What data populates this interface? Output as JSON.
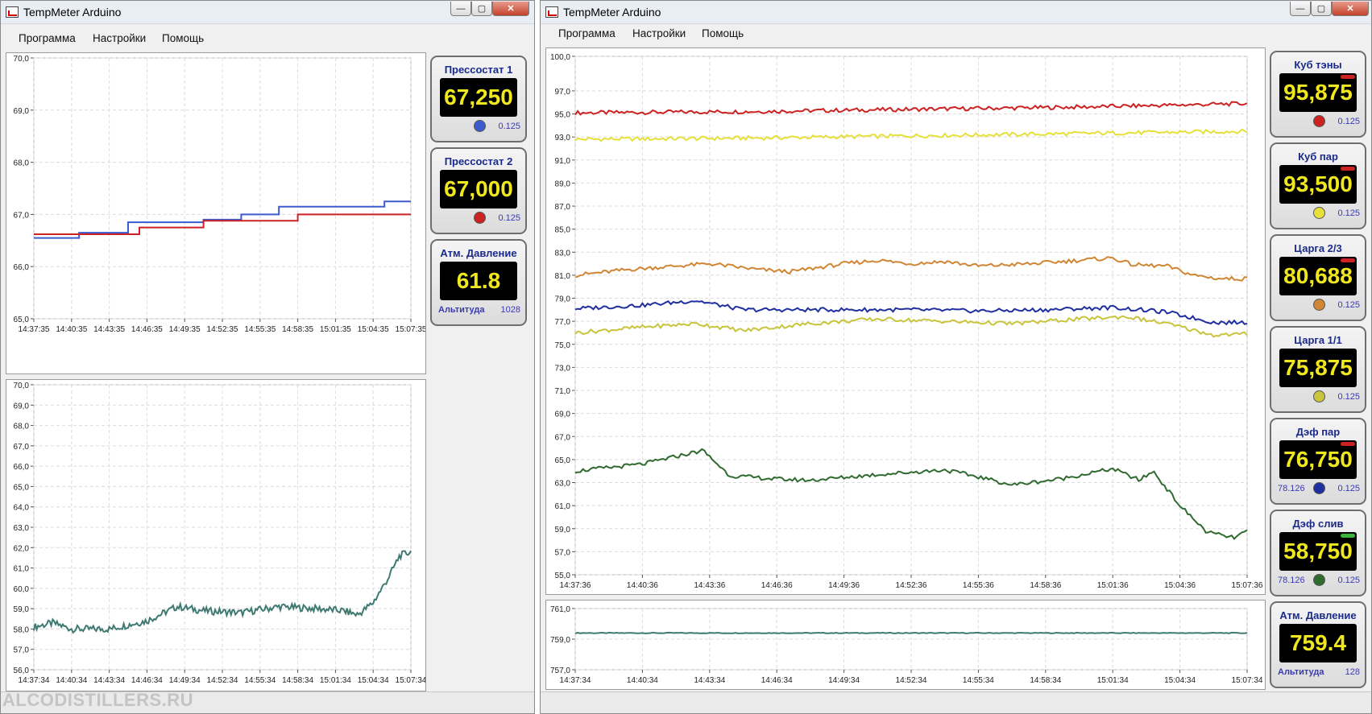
{
  "colors": {
    "red": "#cc2222",
    "yellow": "#e6e03a",
    "orange": "#d08634",
    "blue": "#1f2fa0",
    "olive": "#c8c43c",
    "green": "#2f6a2f",
    "teal": "#3e7a72",
    "plotblue": "#3b5bd0"
  },
  "left_window": {
    "title": "TempMeter Arduino",
    "controls": {
      "minimize": "—",
      "maximize": "▢",
      "close": "✕"
    },
    "menu": [
      "Программа",
      "Настройки",
      "Помощь"
    ],
    "chart_data": [
      {
        "type": "line",
        "ylim": [
          65.0,
          70.0
        ],
        "yticks": [
          "70,0",
          "69,0",
          "68,0",
          "67,0",
          "66,0",
          "65,0"
        ],
        "xticks": [
          "14:37:35",
          "14:40:35",
          "14:43:35",
          "14:46:35",
          "14:49:35",
          "14:52:35",
          "14:55:35",
          "14:58:35",
          "15:01:35",
          "15:04:35",
          "15:07:35"
        ],
        "series": [
          {
            "color": "plotblue",
            "points": [
              [
                0,
                66.55
              ],
              [
                0.12,
                66.55
              ],
              [
                0.12,
                66.65
              ],
              [
                0.25,
                66.65
              ],
              [
                0.25,
                66.85
              ],
              [
                0.45,
                66.85
              ],
              [
                0.45,
                66.9
              ],
              [
                0.55,
                66.9
              ],
              [
                0.55,
                67.0
              ],
              [
                0.65,
                67.0
              ],
              [
                0.65,
                67.15
              ],
              [
                0.75,
                67.15
              ],
              [
                0.75,
                67.15
              ],
              [
                0.85,
                67.15
              ],
              [
                0.85,
                67.15
              ],
              [
                0.93,
                67.15
              ],
              [
                0.93,
                67.25
              ],
              [
                1.0,
                67.25
              ]
            ]
          },
          {
            "color": "red",
            "points": [
              [
                0,
                66.62
              ],
              [
                0.17,
                66.62
              ],
              [
                0.17,
                66.62
              ],
              [
                0.28,
                66.62
              ],
              [
                0.28,
                66.75
              ],
              [
                0.45,
                66.75
              ],
              [
                0.45,
                66.88
              ],
              [
                0.7,
                66.88
              ],
              [
                0.7,
                67.0
              ],
              [
                1.0,
                67.0
              ]
            ]
          }
        ]
      },
      {
        "type": "line",
        "ylim": [
          56.0,
          70.0
        ],
        "yticks": [
          "70,0",
          "69,0",
          "68,0",
          "67,0",
          "66,0",
          "65,0",
          "64,0",
          "63,0",
          "62,0",
          "61,0",
          "60,0",
          "59,0",
          "58,0",
          "57,0",
          "56,0"
        ],
        "xticks": [
          "14:37:34",
          "14:40:34",
          "14:43:34",
          "14:46:34",
          "14:49:34",
          "14:52:34",
          "14:55:34",
          "14:58:34",
          "15:01:34",
          "15:04:34",
          "15:07:34"
        ],
        "series": [
          {
            "color": "teal",
            "points": [
              [
                0,
                58.1
              ],
              [
                0.05,
                58.3
              ],
              [
                0.1,
                58.0
              ],
              [
                0.2,
                58.0
              ],
              [
                0.3,
                58.4
              ],
              [
                0.38,
                59.1
              ],
              [
                0.45,
                58.9
              ],
              [
                0.55,
                58.8
              ],
              [
                0.65,
                59.1
              ],
              [
                0.75,
                59.0
              ],
              [
                0.82,
                58.9
              ],
              [
                0.86,
                58.7
              ],
              [
                0.9,
                59.3
              ],
              [
                0.94,
                60.5
              ],
              [
                0.97,
                61.6
              ],
              [
                1.0,
                61.8
              ]
            ]
          }
        ]
      }
    ],
    "gauges": [
      {
        "title": "Прессостат 1",
        "value": "67,250",
        "dot": "plotblue",
        "res": "0.125"
      },
      {
        "title": "Прессостат 2",
        "value": "67,000",
        "dot": "red",
        "res": "0.125"
      },
      {
        "title": "Атм. Давление",
        "value": "61.8",
        "left": "Альтитуда",
        "res": "1028"
      }
    ]
  },
  "right_window": {
    "title": "TempMeter Arduino",
    "controls": {
      "minimize": "—",
      "maximize": "▢",
      "close": "✕"
    },
    "menu": [
      "Программа",
      "Настройки",
      "Помощь"
    ],
    "chart_data": [
      {
        "type": "line",
        "ylim": [
          55.0,
          100.0
        ],
        "yticks": [
          "100,0",
          "97,0",
          "95,0",
          "93,0",
          "91,0",
          "89,0",
          "87,0",
          "85,0",
          "83,0",
          "81,0",
          "79,0",
          "77,0",
          "75,0",
          "73,0",
          "71,0",
          "69,0",
          "67,0",
          "65,0",
          "63,0",
          "61,0",
          "59,0",
          "57,0",
          "55,0"
        ],
        "xticks": [
          "14:37:36",
          "14:40:36",
          "14:43:36",
          "14:46:36",
          "14:49:36",
          "14:52:36",
          "14:55:36",
          "14:58:36",
          "15:01:36",
          "15:04:36",
          "15:07:36"
        ],
        "series": [
          {
            "color": "red",
            "points": [
              [
                0,
                95.1
              ],
              [
                0.25,
                95.2
              ],
              [
                0.5,
                95.4
              ],
              [
                0.75,
                95.6
              ],
              [
                1.0,
                95.9
              ]
            ]
          },
          {
            "color": "yellow",
            "points": [
              [
                0,
                92.8
              ],
              [
                0.25,
                92.9
              ],
              [
                0.5,
                93.1
              ],
              [
                0.75,
                93.3
              ],
              [
                1.0,
                93.5
              ]
            ]
          },
          {
            "color": "orange",
            "points": [
              [
                0,
                81.0
              ],
              [
                0.08,
                81.5
              ],
              [
                0.15,
                81.8
              ],
              [
                0.2,
                82.0
              ],
              [
                0.27,
                81.5
              ],
              [
                0.32,
                81.3
              ],
              [
                0.4,
                82.0
              ],
              [
                0.45,
                82.3
              ],
              [
                0.5,
                82.0
              ],
              [
                0.55,
                82.2
              ],
              [
                0.6,
                81.8
              ],
              [
                0.68,
                82.0
              ],
              [
                0.75,
                82.3
              ],
              [
                0.8,
                82.5
              ],
              [
                0.83,
                81.9
              ],
              [
                0.88,
                81.8
              ],
              [
                0.92,
                81.0
              ],
              [
                0.96,
                80.7
              ],
              [
                1.0,
                80.7
              ]
            ]
          },
          {
            "color": "blue",
            "points": [
              [
                0,
                78.1
              ],
              [
                0.1,
                78.4
              ],
              [
                0.18,
                78.8
              ],
              [
                0.25,
                78.0
              ],
              [
                0.4,
                78.0
              ],
              [
                0.5,
                78.0
              ],
              [
                0.6,
                77.9
              ],
              [
                0.7,
                78.0
              ],
              [
                0.8,
                78.2
              ],
              [
                0.88,
                77.8
              ],
              [
                0.95,
                76.9
              ],
              [
                1.0,
                76.9
              ]
            ]
          },
          {
            "color": "olive",
            "points": [
              [
                0,
                76.0
              ],
              [
                0.1,
                76.5
              ],
              [
                0.18,
                76.8
              ],
              [
                0.25,
                76.2
              ],
              [
                0.35,
                76.8
              ],
              [
                0.45,
                77.2
              ],
              [
                0.55,
                77.0
              ],
              [
                0.65,
                76.8
              ],
              [
                0.75,
                77.2
              ],
              [
                0.82,
                77.4
              ],
              [
                0.88,
                76.8
              ],
              [
                0.95,
                75.8
              ],
              [
                1.0,
                75.9
              ]
            ]
          },
          {
            "color": "green",
            "points": [
              [
                0,
                64.0
              ],
              [
                0.1,
                64.6
              ],
              [
                0.19,
                65.8
              ],
              [
                0.23,
                63.6
              ],
              [
                0.3,
                63.3
              ],
              [
                0.35,
                63.2
              ],
              [
                0.45,
                63.7
              ],
              [
                0.55,
                64.1
              ],
              [
                0.6,
                63.5
              ],
              [
                0.65,
                62.8
              ],
              [
                0.72,
                63.3
              ],
              [
                0.8,
                64.2
              ],
              [
                0.84,
                63.2
              ],
              [
                0.86,
                64.0
              ],
              [
                0.9,
                61.0
              ],
              [
                0.94,
                58.7
              ],
              [
                0.98,
                58.2
              ],
              [
                1.0,
                58.8
              ]
            ]
          }
        ]
      },
      {
        "type": "line",
        "ylim": [
          757.0,
          761.0
        ],
        "yticks": [
          "761,0",
          "759,0",
          "757,0"
        ],
        "xticks": [
          "14:37:34",
          "14:40:34",
          "14:43:34",
          "14:46:34",
          "14:49:34",
          "14:52:34",
          "14:55:34",
          "14:58:34",
          "15:01:34",
          "15:04:34",
          "15:07:34"
        ],
        "series": [
          {
            "color": "teal",
            "points": [
              [
                0,
                759.4
              ],
              [
                0.5,
                759.4
              ],
              [
                1.0,
                759.4
              ]
            ]
          }
        ]
      }
    ],
    "gauges": [
      {
        "title": "Куб тэны",
        "value": "95,875",
        "dot": "red",
        "bar": "red",
        "res": "0.125"
      },
      {
        "title": "Куб пар",
        "value": "93,500",
        "dot": "yellow",
        "bar": "red",
        "res": "0.125"
      },
      {
        "title": "Царга 2/3",
        "value": "80,688",
        "dot": "orange",
        "bar": "red",
        "res": "0.125"
      },
      {
        "title": "Царга 1/1",
        "value": "75,875",
        "dot": "olive",
        "res": "0.125"
      },
      {
        "title": "Дэф пар",
        "value": "76,750",
        "dot": "blue",
        "bar": "red",
        "left": "78.126",
        "res": "0.125"
      },
      {
        "title": "Дэф слив",
        "value": "58,750",
        "dot": "green",
        "bar": "#3cb43c",
        "left": "78.126",
        "res": "0.125"
      },
      {
        "title": "Атм. Давление",
        "value": "759.4",
        "left": "Альтитуда",
        "res": "128"
      }
    ]
  },
  "watermark": "ALCODISTILLERS.RU"
}
